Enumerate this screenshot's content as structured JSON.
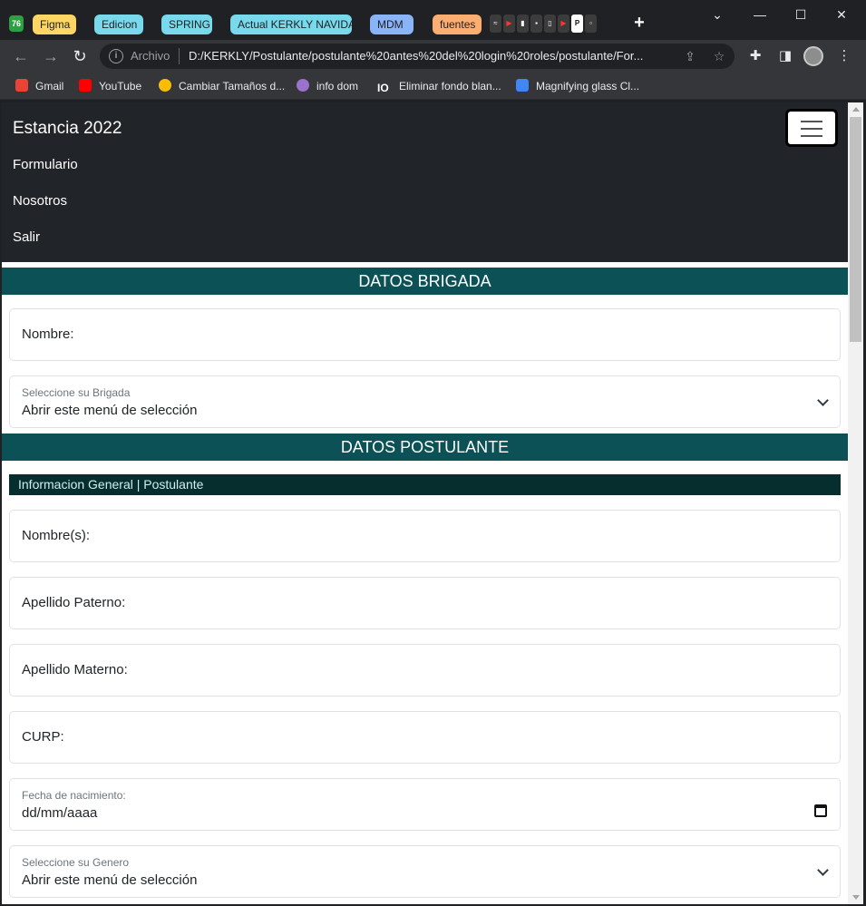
{
  "browser": {
    "app_badge": "76",
    "tab_groups": [
      {
        "label": "Figma",
        "color": "#fdd663"
      },
      {
        "label": "Edicion",
        "color": "#78d9ec"
      },
      {
        "label": "SPRING",
        "color": "#78d9ec"
      },
      {
        "label": "Actual KERKLY NAVIDAD",
        "color": "#78d9ec"
      },
      {
        "label": "MDM",
        "color": "#8ab4f8"
      },
      {
        "label": "fuentes",
        "color": "#fcad70"
      }
    ],
    "new_tab": "+",
    "window_controls": {
      "minimize": "—",
      "maximize": "☐",
      "close": "✕",
      "chevron": "⌄"
    },
    "address": {
      "scheme_label": "Archivo",
      "url": "D:/KERKLY/Postulante/postulante%20antes%20del%20login%20roles/postulante/For..."
    },
    "bookmarks": [
      {
        "label": "Gmail",
        "icon": "gmail-icon",
        "color": "#ea4335"
      },
      {
        "label": "YouTube",
        "icon": "youtube-icon",
        "color": "#ff0000"
      },
      {
        "label": "Cambiar Tamaños d...",
        "icon": "chrome-color-icon",
        "color": "#fbbc04"
      },
      {
        "label": "info dom",
        "icon": "globe-icon",
        "color": "#9b72cb"
      },
      {
        "label": "Eliminar fondo blan...",
        "icon": "io-icon",
        "color": "#ffffff"
      },
      {
        "label": "Magnifying glass Cl...",
        "icon": "flag-icon",
        "color": "#4285f4"
      }
    ]
  },
  "page": {
    "brand": "Estancia 2022",
    "nav_links": [
      "Formulario",
      "Nosotros",
      "Salir"
    ],
    "section_brigada": "DATOS BRIGADA",
    "brigada_nombre_label": "Nombre:",
    "brigada_select": {
      "label": "Seleccione su Brigada",
      "value": "Abrir este menú de selección"
    },
    "section_postulante": "DATOS POSTULANTE",
    "subheader": "Informacion General | Postulante",
    "fields": {
      "nombres": "Nombre(s):",
      "apellido_paterno": "Apellido Paterno:",
      "apellido_materno": "Apellido Materno:",
      "curp": "CURP:"
    },
    "fecha": {
      "label": "Fecha de nacimiento:",
      "value": "dd/mm/aaaa"
    },
    "genero_select": {
      "label": "Seleccione su Genero",
      "value": "Abrir este menú de selección"
    }
  }
}
